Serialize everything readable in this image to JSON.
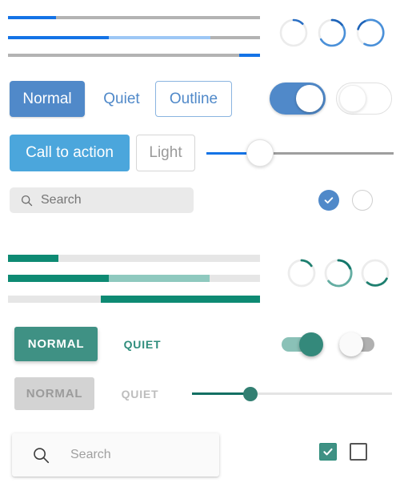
{
  "theme": {
    "spectrum_blue": "#1473e6",
    "spectrum_blue_light": "#9dc7f5",
    "button_blue": "#5089c9",
    "cta_blue": "#4ba6dc",
    "track_gray": "#b3b3b3",
    "material_teal": "#3f9184",
    "material_teal_dark": "#0e8a73",
    "material_teal_buffer": "#8fc9bf",
    "material_track_gray": "#e6e6e6",
    "disabled_gray": "#d3d3d3"
  },
  "spectrum": {
    "progress_bars": [
      {
        "name": "determinate",
        "value": 20,
        "buffer": 0,
        "align": "left"
      },
      {
        "name": "buffered",
        "value": 40,
        "buffer": 80,
        "align": "left"
      },
      {
        "name": "right-aligned",
        "value": 8,
        "buffer": 0,
        "align": "right"
      }
    ],
    "spinners": [
      {
        "name": "spinner-small-arc",
        "percent": 12
      },
      {
        "name": "spinner-medium-arc",
        "percent": 60
      },
      {
        "name": "spinner-large-arc",
        "percent": 85
      }
    ],
    "buttons": {
      "normal_label": "Normal",
      "quiet_label": "Quiet",
      "outline_label": "Outline",
      "cta_label": "Call to action",
      "light_label": "Light"
    },
    "switches": [
      {
        "name": "switch-on",
        "checked": true
      },
      {
        "name": "switch-off",
        "checked": false
      }
    ],
    "slider": {
      "value": 30,
      "min": 0,
      "max": 100
    },
    "search": {
      "placeholder": "Search",
      "value": "",
      "icon": "search-icon"
    },
    "checkboxes": [
      {
        "name": "circle-checkbox-checked",
        "checked": true,
        "shape": "circle"
      },
      {
        "name": "circle-checkbox-unchecked",
        "checked": false,
        "shape": "circle"
      }
    ]
  },
  "material": {
    "progress_bars": [
      {
        "name": "determinate",
        "value": 20,
        "buffer": 0,
        "align": "left"
      },
      {
        "name": "buffered",
        "value": 40,
        "buffer": 80,
        "align": "left"
      },
      {
        "name": "right-aligned",
        "value": 63,
        "buffer": 0,
        "align": "right"
      }
    ],
    "spinners": [
      {
        "name": "spinner-small-arc",
        "percent": 12
      },
      {
        "name": "spinner-medium-arc",
        "percent": 70
      },
      {
        "name": "spinner-large-arc",
        "percent": 30
      }
    ],
    "buttons": {
      "normal_label": "NORMAL",
      "quiet_label": "QUIET",
      "disabled_normal_label": "NORMAL",
      "disabled_quiet_label": "QUIET"
    },
    "switches": [
      {
        "name": "switch-on",
        "checked": true
      },
      {
        "name": "switch-off",
        "checked": false
      }
    ],
    "slider": {
      "value": 30,
      "min": 0,
      "max": 100
    },
    "search": {
      "placeholder": "Search",
      "value": "",
      "icon": "search-icon"
    },
    "checkboxes": [
      {
        "name": "square-checkbox-checked",
        "checked": true,
        "shape": "square"
      },
      {
        "name": "square-checkbox-unchecked",
        "checked": false,
        "shape": "square"
      }
    ]
  }
}
